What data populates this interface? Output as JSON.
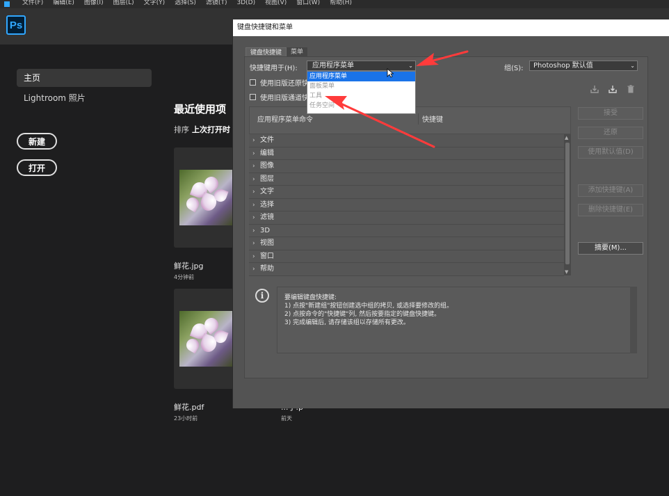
{
  "menubar": {
    "items": [
      "文件(F)",
      "编辑(E)",
      "图像(I)",
      "图层(L)",
      "文字(Y)",
      "选择(S)",
      "滤镜(T)",
      "3D(D)",
      "视图(V)",
      "窗口(W)",
      "帮助(H)"
    ]
  },
  "app": {
    "logo": "Ps"
  },
  "home": {
    "nav_home": "主页",
    "nav_lightroom": "Lightroom 照片",
    "new_button": "新建",
    "open_button": "打开",
    "recent_title": "最近使用项",
    "sort_label": "排序",
    "sort_value": "上次打开时",
    "files": [
      {
        "name": "鲜花.jpg",
        "time": "4分钟前"
      },
      {
        "name": "鲜花.pdf",
        "time": "23小时前"
      },
      {
        "name": "...于.p",
        "time": "前天"
      }
    ]
  },
  "dialog": {
    "title": "键盘快捷键和菜单",
    "tabs": [
      "键盘快捷键",
      "菜单"
    ],
    "shortcuts_for_label": "快捷键用于(H):",
    "shortcuts_for_value": "应用程序菜单",
    "dropdown_options": [
      "应用程序菜单",
      "面板菜单",
      "工具",
      "任务空间"
    ],
    "group_label": "组(S):",
    "group_value": "Photoshop 默认值",
    "checkbox_legacy_undo": "使用旧版还原快捷键",
    "checkbox_legacy_channel": "使用旧版通道快捷键",
    "col_command": "应用程序菜单命令",
    "col_shortcut": "快捷键",
    "rows": [
      "文件",
      "编辑",
      "图像",
      "图层",
      "文字",
      "选择",
      "滤镜",
      "3D",
      "视图",
      "窗口",
      "帮助"
    ],
    "buttons": {
      "accept": "接受",
      "undo": "还原",
      "use_default": "使用默认值(D)",
      "add_shortcut": "添加快捷键(A)",
      "delete_shortcut": "删除快捷键(E)",
      "summarize": "摘要(M)..."
    },
    "info_lines": [
      "要编辑键盘快捷键:",
      "1) 点按\"新建组\"按钮创建选中组的拷贝, 或选择要修改的组。",
      "2) 点按命令的\"快捷键\"列, 然后按要指定的键盘快捷键。",
      "3) 完成编辑后, 请存储该组以存储所有更改。"
    ]
  },
  "colors": {
    "accent": "#31a8ff",
    "selection": "#1a73e8",
    "annotation": "#ff3b3b"
  }
}
